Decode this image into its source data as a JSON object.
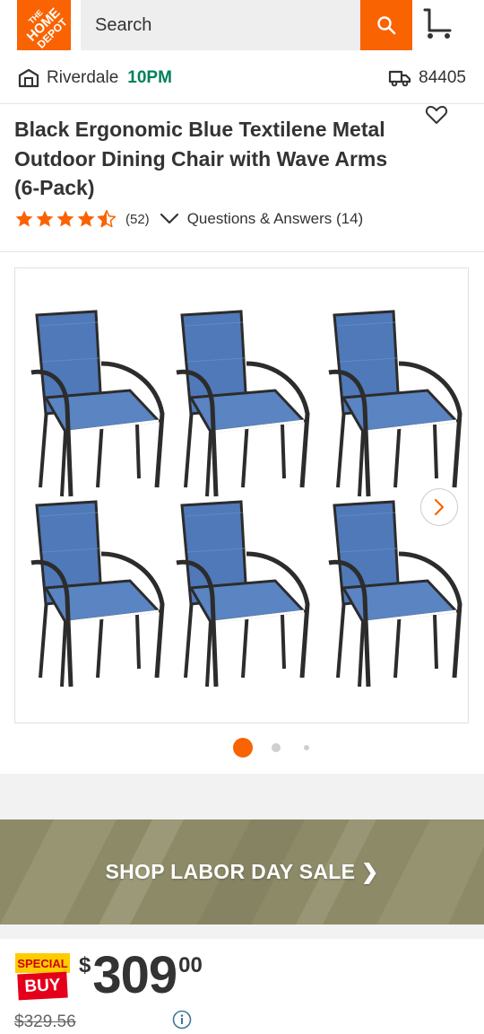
{
  "header": {
    "logo_text": "THE HOME DEPOT",
    "search_placeholder": "Search",
    "brand_color": "#f96302"
  },
  "store_bar": {
    "store_name": "Riverdale",
    "store_hours": "10PM",
    "zip": "84405"
  },
  "product": {
    "title": "Black Ergonomic Blue Textilene Metal Outdoor Dining Chair with Wave Arms (6-Pack)",
    "rating": 4.5,
    "review_count": "(52)",
    "qa_label": "Questions & Answers (14)"
  },
  "gallery": {
    "image_alt": "six blue textilene dining chairs",
    "active_dot": 1,
    "dot_count": 3
  },
  "banner": {
    "text": "SHOP LABOR DAY SALE ❯"
  },
  "pricing": {
    "badge_top": "SPECIAL",
    "badge_bottom": "BUY",
    "currency": "$",
    "dollars": "309",
    "cents": "00",
    "was_price": "$329.56"
  },
  "colors": {
    "accent": "#f96302",
    "store_hours": "#00805b",
    "star": "#f96302"
  }
}
